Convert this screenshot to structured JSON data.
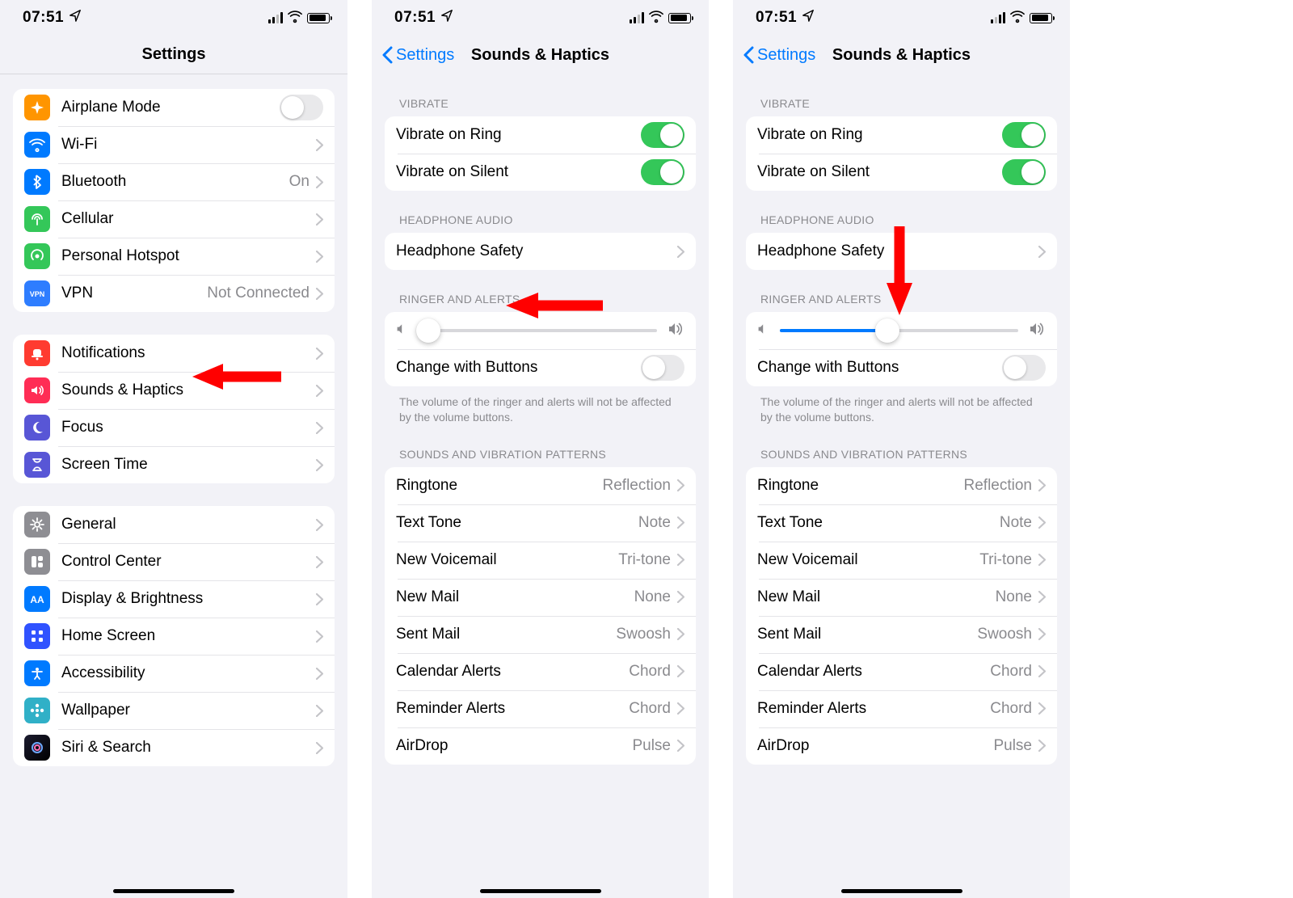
{
  "status": {
    "time": "07:51"
  },
  "p1": {
    "title": "Settings",
    "g1": [
      {
        "icon": "airplane",
        "color": "c-orange",
        "label": "Airplane Mode",
        "toggle": false
      },
      {
        "icon": "wifi",
        "color": "c-blue",
        "label": "Wi-Fi",
        "value": "",
        "chev": true
      },
      {
        "icon": "bluetooth",
        "color": "c-blue",
        "label": "Bluetooth",
        "value": "On",
        "chev": true
      },
      {
        "icon": "cellular",
        "color": "c-green",
        "label": "Cellular",
        "value": "",
        "chev": true
      },
      {
        "icon": "hotspot",
        "color": "c-greenhs",
        "label": "Personal Hotspot",
        "value": "",
        "chev": true
      },
      {
        "icon": "vpn",
        "color": "c-vpn",
        "label": "VPN",
        "value": "Not Connected",
        "chev": true
      }
    ],
    "g2": [
      {
        "icon": "bell",
        "color": "c-red",
        "label": "Notifications",
        "chev": true
      },
      {
        "icon": "sound",
        "color": "c-pink",
        "label": "Sounds & Haptics",
        "chev": true
      },
      {
        "icon": "moon",
        "color": "c-focus",
        "label": "Focus",
        "chev": true
      },
      {
        "icon": "hourglass",
        "color": "screentime-ic",
        "label": "Screen Time",
        "chev": true
      }
    ],
    "g3": [
      {
        "icon": "gear",
        "color": "c-grey",
        "label": "General",
        "chev": true
      },
      {
        "icon": "cc",
        "color": "c-grey",
        "label": "Control Center",
        "chev": true
      },
      {
        "icon": "aa",
        "color": "c-bright",
        "label": "Display & Brightness",
        "chev": true
      },
      {
        "icon": "grid",
        "color": "homescreen-ic",
        "label": "Home Screen",
        "chev": true
      },
      {
        "icon": "acc",
        "color": "c-bright",
        "label": "Accessibility",
        "chev": true
      },
      {
        "icon": "flower",
        "color": "c-teal",
        "label": "Wallpaper",
        "chev": true
      },
      {
        "icon": "siri",
        "color": "siri",
        "label": "Siri & Search",
        "chev": true
      }
    ]
  },
  "sh": {
    "back": "Settings",
    "title": "Sounds & Haptics",
    "sec_vibrate": "VIBRATE",
    "vibrate_ring": "Vibrate on Ring",
    "vibrate_silent": "Vibrate on Silent",
    "sec_headphone": "HEADPHONE AUDIO",
    "headphone_safety": "Headphone Safety",
    "sec_ringer": "RINGER AND ALERTS",
    "change_buttons": "Change with Buttons",
    "footer": "The volume of the ringer and alerts will not be affected by the volume buttons.",
    "sec_patterns": "SOUNDS AND VIBRATION PATTERNS",
    "rows": [
      {
        "label": "Ringtone",
        "value": "Reflection"
      },
      {
        "label": "Text Tone",
        "value": "Note"
      },
      {
        "label": "New Voicemail",
        "value": "Tri-tone"
      },
      {
        "label": "New Mail",
        "value": "None"
      },
      {
        "label": "Sent Mail",
        "value": "Swoosh"
      },
      {
        "label": "Calendar Alerts",
        "value": "Chord"
      },
      {
        "label": "Reminder Alerts",
        "value": "Chord"
      },
      {
        "label": "AirDrop",
        "value": "Pulse"
      }
    ]
  },
  "p2": {
    "slider_pct": 4
  },
  "p3": {
    "slider_pct": 45
  }
}
